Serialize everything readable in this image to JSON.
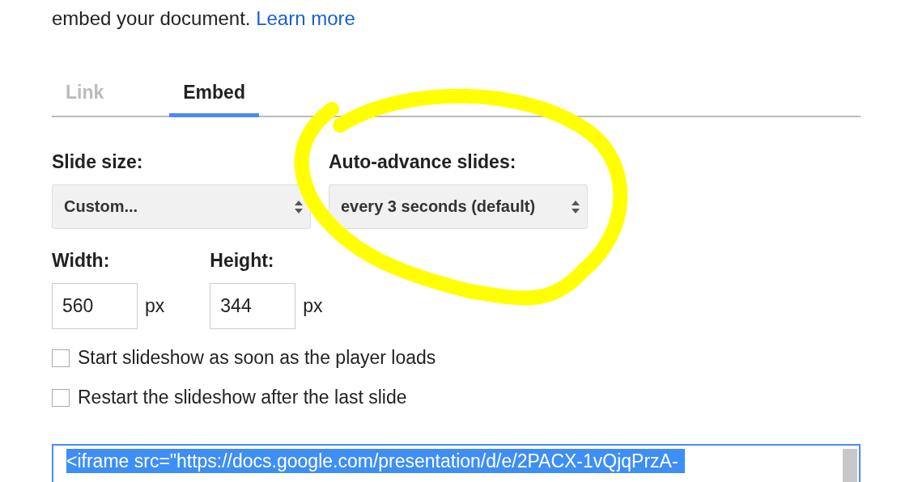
{
  "intro": {
    "text": "embed your document.",
    "link": "Learn more"
  },
  "tabs": [
    {
      "label": "Link",
      "selected": false
    },
    {
      "label": "Embed",
      "selected": true
    }
  ],
  "selects": [
    {
      "label": "Slide size:",
      "value": "Custom..."
    },
    {
      "label": "Auto-advance slides:",
      "value": "every 3 seconds (default)"
    }
  ],
  "size_fields": [
    {
      "label": "Width:",
      "value": "560",
      "unit": "px"
    },
    {
      "label": "Height:",
      "value": "344",
      "unit": "px"
    }
  ],
  "options": [
    {
      "label": "Start slideshow as soon as the player loads",
      "checked": false
    },
    {
      "label": "Restart the slideshow after the last slide",
      "checked": false
    }
  ],
  "embed_code": {
    "text": "<iframe src=\"https://docs.google.com/presentation/d/e/2PACX-1vQjqPrzA-",
    "selected": true
  }
}
